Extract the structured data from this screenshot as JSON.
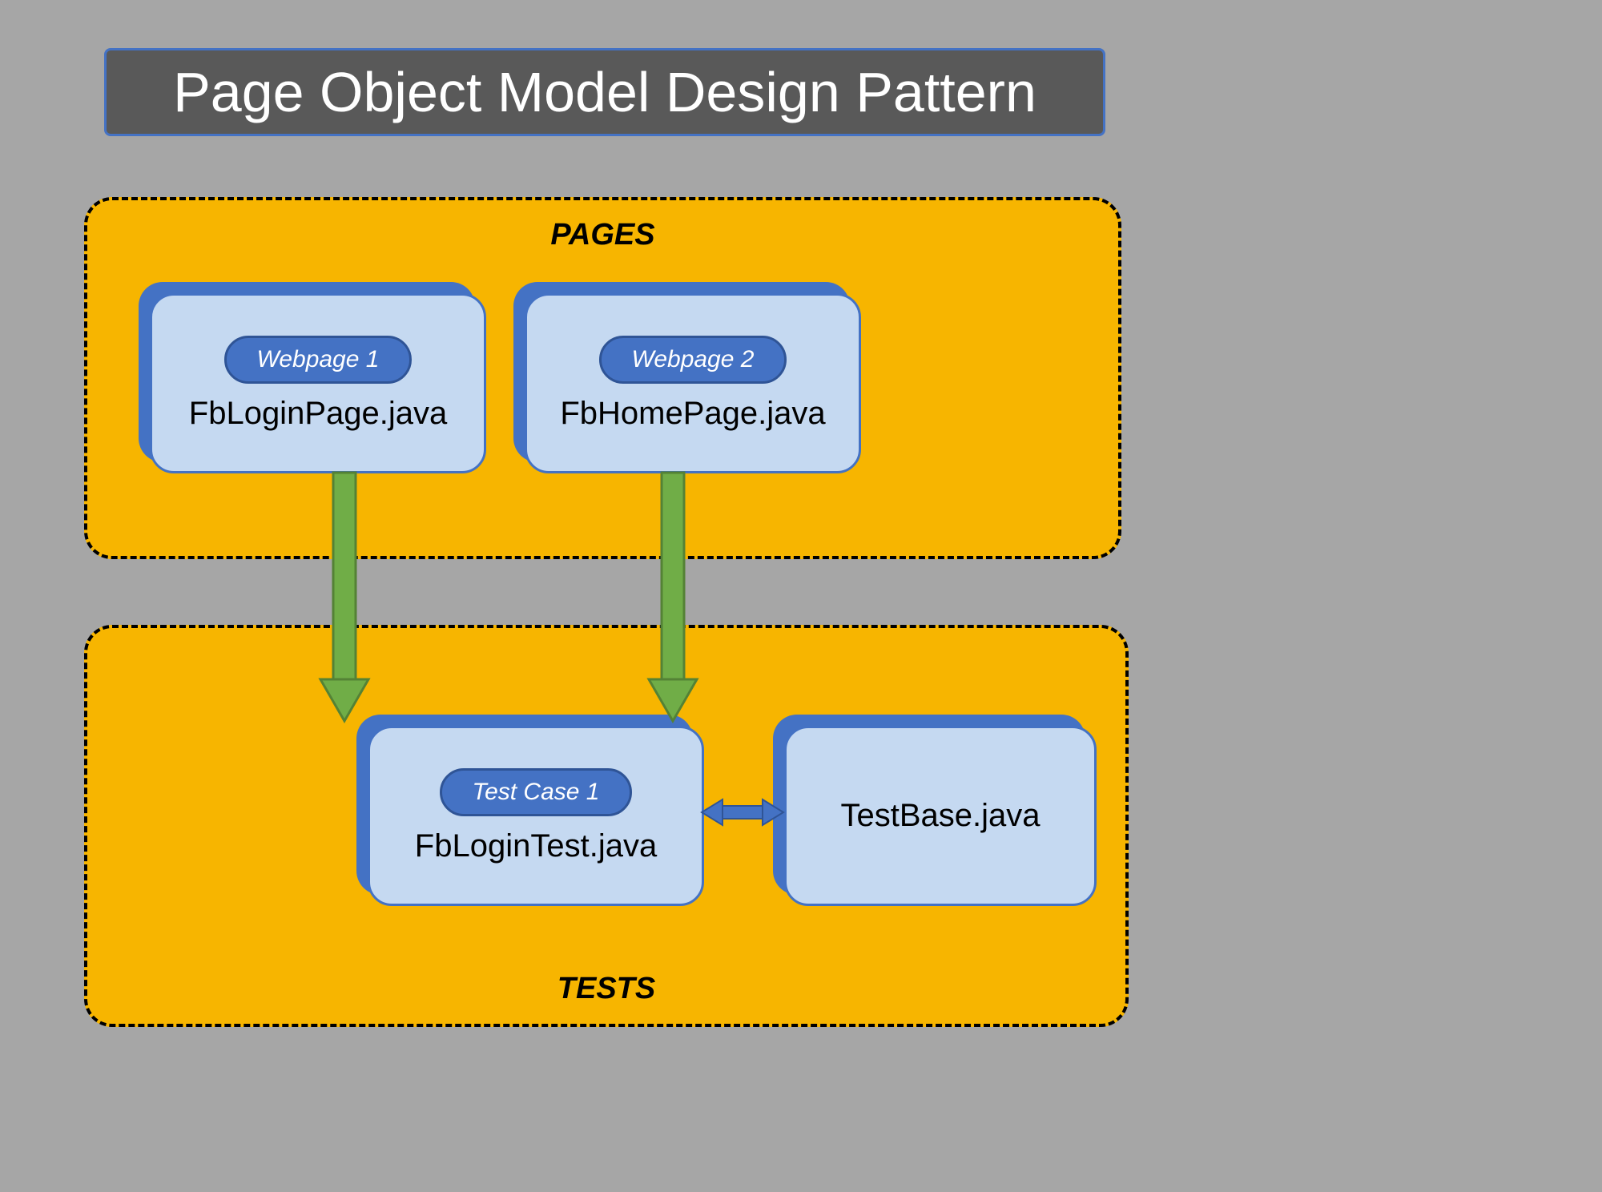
{
  "title": "Page Object Model Design Pattern",
  "regions": {
    "pages": {
      "label": "PAGES",
      "cards": [
        {
          "pill": "Webpage 1",
          "title": "FbLoginPage.java"
        },
        {
          "pill": "Webpage 2",
          "title": "FbHomePage.java"
        }
      ]
    },
    "tests": {
      "label": "TESTS",
      "cards": [
        {
          "pill": "Test Case 1",
          "title": "FbLoginTest.java"
        },
        {
          "pill": null,
          "title": "TestBase.java"
        }
      ]
    }
  }
}
